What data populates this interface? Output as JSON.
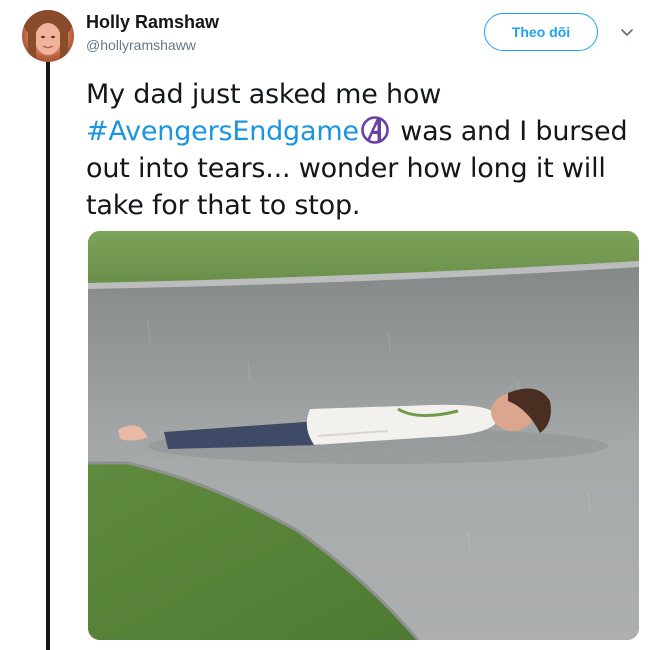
{
  "tweet": {
    "author_name": "Holly Ramshaw",
    "author_handle": "@hollyramshaww",
    "follow_label": "Theo dõi",
    "text_before": "My dad just asked me how ",
    "hashtag": "#AvengersEndgame",
    "hashflag_icon": "avengers-logo-icon",
    "text_after": " was and I bursed out into tears... wonder how long it will take for that to stop."
  },
  "colors": {
    "accent": "#1da1f2",
    "hashtag": "#1b95e0",
    "text": "#14171a",
    "muted": "#657786",
    "avengers_purple": "#6b3fa8"
  },
  "media": {
    "description_icon": "photo-person-lying-in-rain"
  }
}
